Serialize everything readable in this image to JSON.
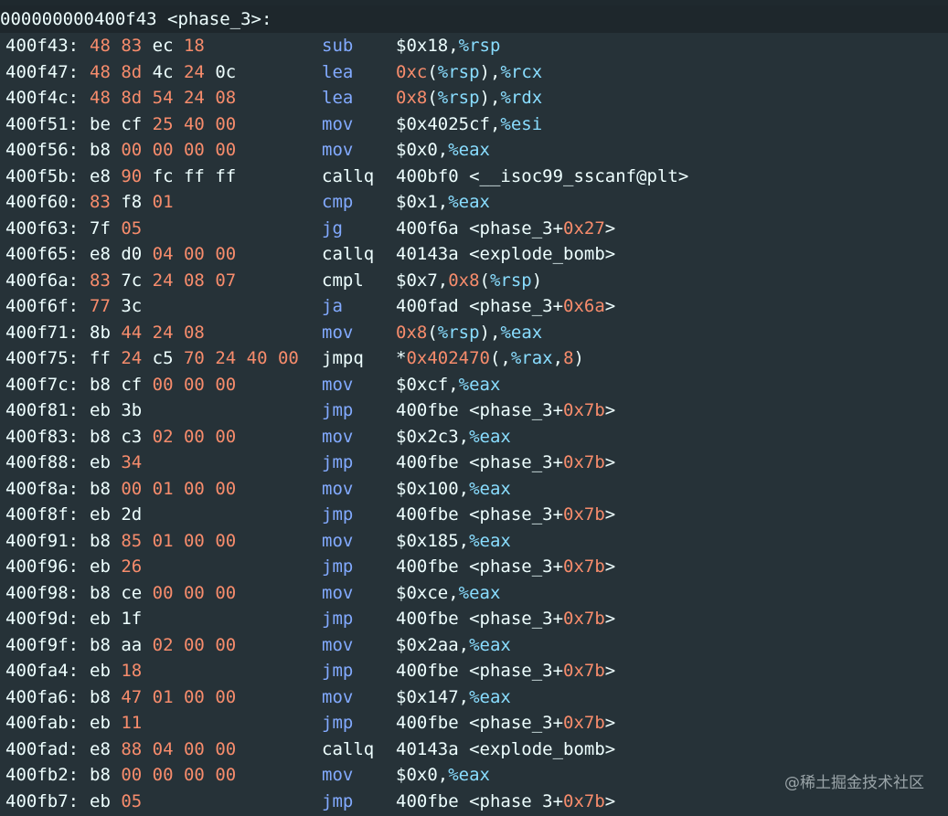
{
  "header": "000000000400f43 <phase_3>:",
  "watermark": "@稀土掘金技术社区",
  "lines": [
    {
      "addr": "400f43:",
      "bytes": [
        [
          "48",
          "r"
        ],
        [
          "83",
          "r"
        ],
        [
          "ec",
          "w"
        ],
        [
          "18",
          "r"
        ]
      ],
      "mnem": "sub",
      "mc": "b",
      "ops": [
        [
          "$0x18,",
          "t"
        ],
        [
          "%rsp",
          "r"
        ]
      ]
    },
    {
      "addr": "400f47:",
      "bytes": [
        [
          "48",
          "r"
        ],
        [
          "8d",
          "r"
        ],
        [
          "4c",
          "w"
        ],
        [
          "24",
          "r"
        ],
        [
          "0c",
          "w"
        ]
      ],
      "mnem": "lea",
      "mc": "b",
      "ops": [
        [
          "0xc",
          "n"
        ],
        [
          "(",
          "t"
        ],
        [
          "%rsp",
          "r"
        ],
        [
          "),",
          "t"
        ],
        [
          "%rcx",
          "r"
        ]
      ]
    },
    {
      "addr": "400f4c:",
      "bytes": [
        [
          "48",
          "r"
        ],
        [
          "8d",
          "r"
        ],
        [
          "54",
          "r"
        ],
        [
          "24",
          "r"
        ],
        [
          "08",
          "r"
        ]
      ],
      "mnem": "lea",
      "mc": "b",
      "ops": [
        [
          "0x8",
          "n"
        ],
        [
          "(",
          "t"
        ],
        [
          "%rsp",
          "r"
        ],
        [
          "),",
          "t"
        ],
        [
          "%rdx",
          "r"
        ]
      ]
    },
    {
      "addr": "400f51:",
      "bytes": [
        [
          "be",
          "w"
        ],
        [
          "cf",
          "w"
        ],
        [
          "25",
          "r"
        ],
        [
          "40",
          "r"
        ],
        [
          "00",
          "r"
        ]
      ],
      "mnem": "mov",
      "mc": "b",
      "ops": [
        [
          "$0x4025cf,",
          "t"
        ],
        [
          "%esi",
          "r"
        ]
      ]
    },
    {
      "addr": "400f56:",
      "bytes": [
        [
          "b8",
          "w"
        ],
        [
          "00",
          "r"
        ],
        [
          "00",
          "r"
        ],
        [
          "00",
          "r"
        ],
        [
          "00",
          "r"
        ]
      ],
      "mnem": "mov",
      "mc": "b",
      "ops": [
        [
          "$0x0,",
          "t"
        ],
        [
          "%eax",
          "r"
        ]
      ]
    },
    {
      "addr": "400f5b:",
      "bytes": [
        [
          "e8",
          "w"
        ],
        [
          "90",
          "r"
        ],
        [
          "fc",
          "w"
        ],
        [
          "ff",
          "w"
        ],
        [
          "ff",
          "w"
        ]
      ],
      "mnem": "callq",
      "mc": "w",
      "ops": [
        [
          "400bf0 <__isoc99_sscanf@plt>",
          "t"
        ]
      ]
    },
    {
      "addr": "400f60:",
      "bytes": [
        [
          "83",
          "r"
        ],
        [
          "f8",
          "w"
        ],
        [
          "01",
          "r"
        ]
      ],
      "mnem": "cmp",
      "mc": "b",
      "ops": [
        [
          "$0x1,",
          "t"
        ],
        [
          "%eax",
          "r"
        ]
      ]
    },
    {
      "addr": "400f63:",
      "bytes": [
        [
          "7f",
          "w"
        ],
        [
          "05",
          "r"
        ]
      ],
      "mnem": "jg",
      "mc": "b",
      "ops": [
        [
          "400f6a <phase_3+",
          "t"
        ],
        [
          "0x27",
          "n"
        ],
        [
          ">",
          "t"
        ]
      ]
    },
    {
      "addr": "400f65:",
      "bytes": [
        [
          "e8",
          "w"
        ],
        [
          "d0",
          "w"
        ],
        [
          "04",
          "r"
        ],
        [
          "00",
          "r"
        ],
        [
          "00",
          "r"
        ]
      ],
      "mnem": "callq",
      "mc": "w",
      "ops": [
        [
          "40143a <explode_bomb>",
          "t"
        ]
      ]
    },
    {
      "addr": "400f6a:",
      "bytes": [
        [
          "83",
          "r"
        ],
        [
          "7c",
          "w"
        ],
        [
          "24",
          "r"
        ],
        [
          "08",
          "r"
        ],
        [
          "07",
          "r"
        ]
      ],
      "mnem": "cmpl",
      "mc": "w",
      "ops": [
        [
          "$0x7,",
          "t"
        ],
        [
          "0x8",
          "n"
        ],
        [
          "(",
          "t"
        ],
        [
          "%rsp",
          "r"
        ],
        [
          ")",
          "t"
        ]
      ]
    },
    {
      "addr": "400f6f:",
      "bytes": [
        [
          "77",
          "r"
        ],
        [
          "3c",
          "w"
        ]
      ],
      "mnem": "ja",
      "mc": "b",
      "ops": [
        [
          "400fad <phase_3+",
          "t"
        ],
        [
          "0x6a",
          "n"
        ],
        [
          ">",
          "t"
        ]
      ]
    },
    {
      "addr": "400f71:",
      "bytes": [
        [
          "8b",
          "w"
        ],
        [
          "44",
          "r"
        ],
        [
          "24",
          "r"
        ],
        [
          "08",
          "r"
        ]
      ],
      "mnem": "mov",
      "mc": "b",
      "ops": [
        [
          "0x8",
          "n"
        ],
        [
          "(",
          "t"
        ],
        [
          "%rsp",
          "r"
        ],
        [
          "),",
          "t"
        ],
        [
          "%eax",
          "r"
        ]
      ]
    },
    {
      "addr": "400f75:",
      "bytes": [
        [
          "ff",
          "w"
        ],
        [
          "24",
          "r"
        ],
        [
          "c5",
          "w"
        ],
        [
          "70",
          "r"
        ],
        [
          "24",
          "r"
        ],
        [
          "40",
          "r"
        ],
        [
          "00",
          "r"
        ]
      ],
      "mnem": "jmpq",
      "mc": "w",
      "ops": [
        [
          "*",
          "t"
        ],
        [
          "0x402470",
          "n"
        ],
        [
          "(,",
          "t"
        ],
        [
          "%rax",
          "r"
        ],
        [
          ",",
          "t"
        ],
        [
          "8",
          "n"
        ],
        [
          ")",
          "t"
        ]
      ]
    },
    {
      "addr": "400f7c:",
      "bytes": [
        [
          "b8",
          "w"
        ],
        [
          "cf",
          "w"
        ],
        [
          "00",
          "r"
        ],
        [
          "00",
          "r"
        ],
        [
          "00",
          "r"
        ]
      ],
      "mnem": "mov",
      "mc": "b",
      "ops": [
        [
          "$0xcf,",
          "t"
        ],
        [
          "%eax",
          "r"
        ]
      ]
    },
    {
      "addr": "400f81:",
      "bytes": [
        [
          "eb",
          "w"
        ],
        [
          "3b",
          "w"
        ]
      ],
      "mnem": "jmp",
      "mc": "b",
      "ops": [
        [
          "400fbe <phase_3+",
          "t"
        ],
        [
          "0x7b",
          "n"
        ],
        [
          ">",
          "t"
        ]
      ]
    },
    {
      "addr": "400f83:",
      "bytes": [
        [
          "b8",
          "w"
        ],
        [
          "c3",
          "w"
        ],
        [
          "02",
          "r"
        ],
        [
          "00",
          "r"
        ],
        [
          "00",
          "r"
        ]
      ],
      "mnem": "mov",
      "mc": "b",
      "ops": [
        [
          "$0x2c3,",
          "t"
        ],
        [
          "%eax",
          "r"
        ]
      ]
    },
    {
      "addr": "400f88:",
      "bytes": [
        [
          "eb",
          "w"
        ],
        [
          "34",
          "r"
        ]
      ],
      "mnem": "jmp",
      "mc": "b",
      "ops": [
        [
          "400fbe <phase_3+",
          "t"
        ],
        [
          "0x7b",
          "n"
        ],
        [
          ">",
          "t"
        ]
      ]
    },
    {
      "addr": "400f8a:",
      "bytes": [
        [
          "b8",
          "w"
        ],
        [
          "00",
          "r"
        ],
        [
          "01",
          "r"
        ],
        [
          "00",
          "r"
        ],
        [
          "00",
          "r"
        ]
      ],
      "mnem": "mov",
      "mc": "b",
      "ops": [
        [
          "$0x100,",
          "t"
        ],
        [
          "%eax",
          "r"
        ]
      ]
    },
    {
      "addr": "400f8f:",
      "bytes": [
        [
          "eb",
          "w"
        ],
        [
          "2d",
          "w"
        ]
      ],
      "mnem": "jmp",
      "mc": "b",
      "ops": [
        [
          "400fbe <phase_3+",
          "t"
        ],
        [
          "0x7b",
          "n"
        ],
        [
          ">",
          "t"
        ]
      ]
    },
    {
      "addr": "400f91:",
      "bytes": [
        [
          "b8",
          "w"
        ],
        [
          "85",
          "r"
        ],
        [
          "01",
          "r"
        ],
        [
          "00",
          "r"
        ],
        [
          "00",
          "r"
        ]
      ],
      "mnem": "mov",
      "mc": "b",
      "ops": [
        [
          "$0x185,",
          "t"
        ],
        [
          "%eax",
          "r"
        ]
      ]
    },
    {
      "addr": "400f96:",
      "bytes": [
        [
          "eb",
          "w"
        ],
        [
          "26",
          "r"
        ]
      ],
      "mnem": "jmp",
      "mc": "b",
      "ops": [
        [
          "400fbe <phase_3+",
          "t"
        ],
        [
          "0x7b",
          "n"
        ],
        [
          ">",
          "t"
        ]
      ]
    },
    {
      "addr": "400f98:",
      "bytes": [
        [
          "b8",
          "w"
        ],
        [
          "ce",
          "w"
        ],
        [
          "00",
          "r"
        ],
        [
          "00",
          "r"
        ],
        [
          "00",
          "r"
        ]
      ],
      "mnem": "mov",
      "mc": "b",
      "ops": [
        [
          "$0xce,",
          "t"
        ],
        [
          "%eax",
          "r"
        ]
      ]
    },
    {
      "addr": "400f9d:",
      "bytes": [
        [
          "eb",
          "w"
        ],
        [
          "1f",
          "w"
        ]
      ],
      "mnem": "jmp",
      "mc": "b",
      "ops": [
        [
          "400fbe <phase_3+",
          "t"
        ],
        [
          "0x7b",
          "n"
        ],
        [
          ">",
          "t"
        ]
      ]
    },
    {
      "addr": "400f9f:",
      "bytes": [
        [
          "b8",
          "w"
        ],
        [
          "aa",
          "w"
        ],
        [
          "02",
          "r"
        ],
        [
          "00",
          "r"
        ],
        [
          "00",
          "r"
        ]
      ],
      "mnem": "mov",
      "mc": "b",
      "ops": [
        [
          "$0x2aa,",
          "t"
        ],
        [
          "%eax",
          "r"
        ]
      ]
    },
    {
      "addr": "400fa4:",
      "bytes": [
        [
          "eb",
          "w"
        ],
        [
          "18",
          "r"
        ]
      ],
      "mnem": "jmp",
      "mc": "b",
      "ops": [
        [
          "400fbe <phase_3+",
          "t"
        ],
        [
          "0x7b",
          "n"
        ],
        [
          ">",
          "t"
        ]
      ]
    },
    {
      "addr": "400fa6:",
      "bytes": [
        [
          "b8",
          "w"
        ],
        [
          "47",
          "r"
        ],
        [
          "01",
          "r"
        ],
        [
          "00",
          "r"
        ],
        [
          "00",
          "r"
        ]
      ],
      "mnem": "mov",
      "mc": "b",
      "ops": [
        [
          "$0x147,",
          "t"
        ],
        [
          "%eax",
          "r"
        ]
      ]
    },
    {
      "addr": "400fab:",
      "bytes": [
        [
          "eb",
          "w"
        ],
        [
          "11",
          "r"
        ]
      ],
      "mnem": "jmp",
      "mc": "b",
      "ops": [
        [
          "400fbe <phase_3+",
          "t"
        ],
        [
          "0x7b",
          "n"
        ],
        [
          ">",
          "t"
        ]
      ]
    },
    {
      "addr": "400fad:",
      "bytes": [
        [
          "e8",
          "w"
        ],
        [
          "88",
          "r"
        ],
        [
          "04",
          "r"
        ],
        [
          "00",
          "r"
        ],
        [
          "00",
          "r"
        ]
      ],
      "mnem": "callq",
      "mc": "w",
      "ops": [
        [
          "40143a <explode_bomb>",
          "t"
        ]
      ]
    },
    {
      "addr": "400fb2:",
      "bytes": [
        [
          "b8",
          "w"
        ],
        [
          "00",
          "r"
        ],
        [
          "00",
          "r"
        ],
        [
          "00",
          "r"
        ],
        [
          "00",
          "r"
        ]
      ],
      "mnem": "mov",
      "mc": "b",
      "ops": [
        [
          "$0x0,",
          "t"
        ],
        [
          "%eax",
          "r"
        ]
      ]
    },
    {
      "addr": "400fb7:",
      "bytes": [
        [
          "eb",
          "w"
        ],
        [
          "05",
          "r"
        ]
      ],
      "mnem": "jmp",
      "mc": "b",
      "ops": [
        [
          "400fbe <phase 3+",
          "t"
        ],
        [
          "0x7b",
          "n"
        ],
        [
          ">",
          "t"
        ]
      ]
    }
  ]
}
